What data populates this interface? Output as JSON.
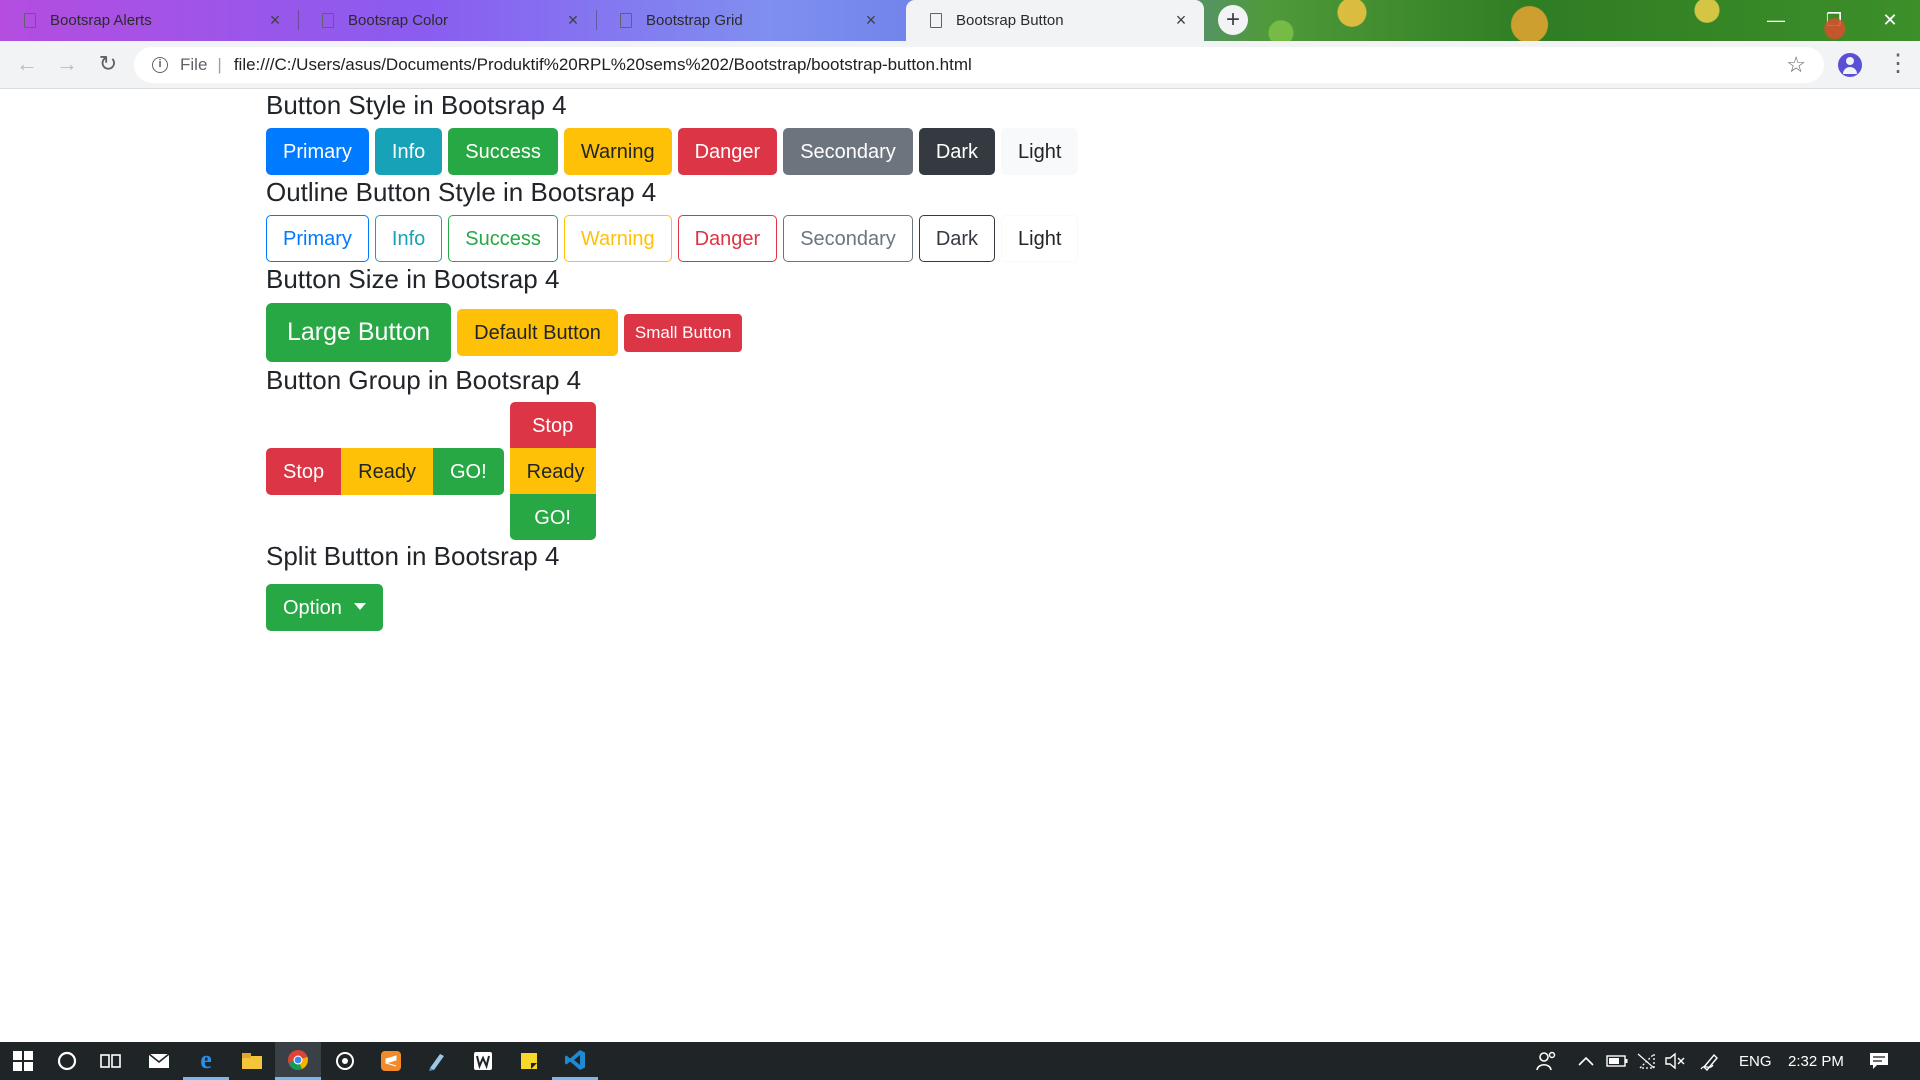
{
  "browser": {
    "tabs": [
      {
        "title": "Bootsrap Alerts",
        "active": false
      },
      {
        "title": "Bootsrap Color",
        "active": false
      },
      {
        "title": "Bootstrap Grid",
        "active": false
      },
      {
        "title": "Bootsrap Button",
        "active": true
      }
    ],
    "close_glyph": "×",
    "new_tab_glyph": "+",
    "window_controls": {
      "minimize": "—",
      "maximize": "❐",
      "close": "✕"
    },
    "nav": {
      "back": "←",
      "forward": "→",
      "reload": "↻"
    },
    "address": {
      "scheme_label": "File",
      "separator": "|",
      "url": "file:///C:/Users/asus/Documents/Produktif%20RPL%20sems%202/Bootstrap/bootstrap-button.html",
      "info_glyph": "i",
      "star_glyph": "☆"
    },
    "menu_glyph": "⋮"
  },
  "page": {
    "styles": {
      "heading": "Button Style in Bootsrap 4",
      "buttons": [
        {
          "label": "Primary",
          "variant": "primary"
        },
        {
          "label": "Info",
          "variant": "info"
        },
        {
          "label": "Success",
          "variant": "success"
        },
        {
          "label": "Warning",
          "variant": "warning"
        },
        {
          "label": "Danger",
          "variant": "danger"
        },
        {
          "label": "Secondary",
          "variant": "secondary"
        },
        {
          "label": "Dark",
          "variant": "dark"
        },
        {
          "label": "Light",
          "variant": "light"
        }
      ]
    },
    "outline": {
      "heading": "Outline Button Style in Bootsrap 4",
      "buttons": [
        {
          "label": "Primary",
          "variant": "outline-primary"
        },
        {
          "label": "Info",
          "variant": "outline-info"
        },
        {
          "label": "Success",
          "variant": "outline-success"
        },
        {
          "label": "Warning",
          "variant": "outline-warning"
        },
        {
          "label": "Danger",
          "variant": "outline-danger"
        },
        {
          "label": "Secondary",
          "variant": "outline-secondary"
        },
        {
          "label": "Dark",
          "variant": "outline-dark"
        },
        {
          "label": "Light",
          "variant": "outline-light"
        }
      ]
    },
    "sizes": {
      "heading": "Button Size in Bootsrap 4",
      "large": "Large Button",
      "default": "Default Button",
      "small": "Small Button"
    },
    "groups": {
      "heading": "Button Group in Bootsrap 4",
      "horizontal": [
        "Stop",
        "Ready",
        "GO!"
      ],
      "vertical": [
        "Stop",
        "Ready",
        "GO!"
      ]
    },
    "split": {
      "heading": "Split Button in Bootsrap 4",
      "label": "Option"
    }
  },
  "taskbar": {
    "apps": [
      "start-icon",
      "cortana-icon",
      "task-view-icon",
      "mail-icon",
      "edge-icon",
      "file-explorer-icon",
      "chrome-icon",
      "media-player-icon",
      "sublime-icon",
      "notepad-icon",
      "word-pad-icon",
      "sticky-notes-icon",
      "vscode-icon"
    ],
    "language": "ENG",
    "time": "2:32 PM"
  },
  "colors": {
    "primary": "#007bff",
    "info": "#17a2b8",
    "success": "#28a745",
    "warning": "#ffc107",
    "danger": "#dc3545",
    "secondary": "#6c757d",
    "dark": "#343a40",
    "light": "#f8f9fa"
  }
}
